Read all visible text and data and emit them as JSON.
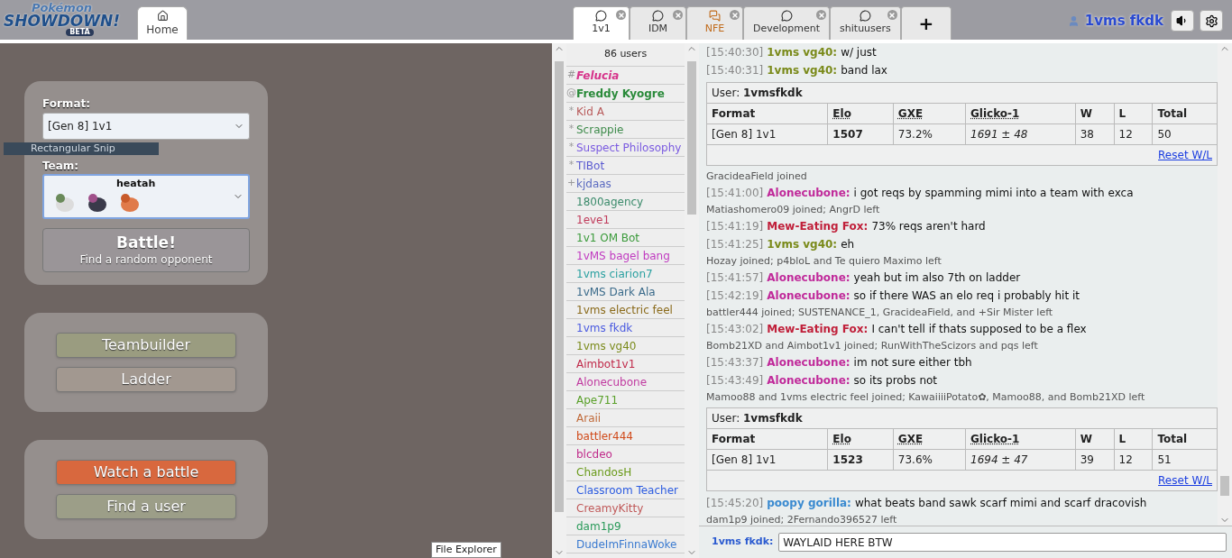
{
  "logo": {
    "line_1": "Pokémon",
    "line_2": "SHOWDOWN!",
    "badge": "BETA"
  },
  "home_tab": {
    "label": "Home",
    "selected": true
  },
  "room_tabs": [
    {
      "label": "1v1",
      "selected": true,
      "notify": false
    },
    {
      "label": "IDM",
      "selected": false,
      "notify": false
    },
    {
      "label": "NFE",
      "selected": false,
      "notify": true
    },
    {
      "label": "Development",
      "selected": false,
      "notify": false
    },
    {
      "label": "shituusers",
      "selected": false,
      "notify": false
    }
  ],
  "new_tab": "+",
  "account": {
    "username": "1vms fkdk"
  },
  "main_menu": {
    "format_label": "Format:",
    "format_value": "[Gen 8] 1v1",
    "team_label": "Team:",
    "team_name": "heatah",
    "battle_button": {
      "title": "Battle!",
      "subtitle": "Find a random opponent"
    },
    "menu_groups": [
      [
        {
          "label": "Teambuilder",
          "color": "#9a9c80"
        },
        {
          "label": "Ladder",
          "color": "#a29890"
        }
      ],
      [
        {
          "label": "Watch a battle",
          "color": "#d8683e"
        },
        {
          "label": "Find a user",
          "color": "#9c9e88"
        }
      ]
    ]
  },
  "overlays": {
    "snip_label": "Rectangular Snip",
    "tooltip": "File Explorer"
  },
  "userlist": {
    "count": "86 users",
    "users": [
      {
        "rank": "#",
        "name": "Felucia",
        "color": "#d6338a",
        "kind": "bold-italic"
      },
      {
        "rank": "@",
        "name": "Freddy Kyogre",
        "color": "#2a8a3a",
        "kind": "bold"
      },
      {
        "rank": "*",
        "name": "Kid A",
        "color": "#b85a5a",
        "kind": "normal"
      },
      {
        "rank": "*",
        "name": "Scrappie",
        "color": "#3d8a4a",
        "kind": "normal"
      },
      {
        "rank": "*",
        "name": "Suspect Philosophy",
        "color": "#7a5ae0",
        "kind": "normal"
      },
      {
        "rank": "*",
        "name": "TIBot",
        "color": "#5a5ad0",
        "kind": "normal"
      },
      {
        "rank": "+",
        "name": "kjdaas",
        "color": "#5a6ac0",
        "kind": "normal"
      },
      {
        "name": "1800agency",
        "color": "#3a8a6a",
        "kind": "normal"
      },
      {
        "name": "1eve1",
        "color": "#c03a5a",
        "kind": "normal"
      },
      {
        "name": "1v1 OM Bot",
        "color": "#3a9a3a",
        "kind": "normal"
      },
      {
        "name": "1vMS bagel bang",
        "color": "#c03ac0",
        "kind": "normal"
      },
      {
        "name": "1vms ciarion7",
        "color": "#2aa0a0",
        "kind": "normal"
      },
      {
        "name": "1vMS Dark Ala",
        "color": "#3a6a8a",
        "kind": "normal"
      },
      {
        "name": "1vms electric feel",
        "color": "#8a6a1a",
        "kind": "normal"
      },
      {
        "name": "1vms fkdk",
        "color": "#4a5ae0",
        "kind": "normal"
      },
      {
        "name": "1vms vg40",
        "color": "#7a8a1a",
        "kind": "normal"
      },
      {
        "name": "Aimbot1v1",
        "color": "#c02a4a",
        "kind": "normal"
      },
      {
        "name": "Alonecubone",
        "color": "#c03aa0",
        "kind": "normal"
      },
      {
        "name": "Ape711",
        "color": "#5aa02a",
        "kind": "normal"
      },
      {
        "name": "Araii",
        "color": "#c06a3a",
        "kind": "normal"
      },
      {
        "name": "battler444",
        "color": "#d04a1a",
        "kind": "normal"
      },
      {
        "name": "blcdeo",
        "color": "#c02a8a",
        "kind": "normal"
      },
      {
        "name": "ChandosH",
        "color": "#6a9a1a",
        "kind": "normal"
      },
      {
        "name": "Classroom Teacher",
        "color": "#2a5ae0",
        "kind": "normal"
      },
      {
        "name": "CreamyKitty",
        "color": "#c05a5a",
        "kind": "normal"
      },
      {
        "name": "dam1p9",
        "color": "#2a9a5a",
        "kind": "normal"
      },
      {
        "name": "DudeImFinnaWoke",
        "color": "#3a7ad0",
        "kind": "normal"
      }
    ]
  },
  "chat": {
    "lines": [
      {
        "kind": "message",
        "time": "[15:40:30]",
        "user": "1vms vg40:",
        "color": "#7a8a1a",
        "text": "w/ just"
      },
      {
        "kind": "message",
        "time": "[15:40:31]",
        "user": "1vms vg40:",
        "color": "#7a8a1a",
        "text": "band lax"
      },
      {
        "kind": "ladder",
        "user_label": "User:",
        "user": "1vmsfkdk",
        "columns": [
          {
            "label": "Format",
            "abbr": false
          },
          {
            "label": "Elo",
            "abbr": true
          },
          {
            "label": "GXE",
            "abbr": true
          },
          {
            "label": "Glicko-1",
            "abbr": true
          },
          {
            "label": "W",
            "abbr": false
          },
          {
            "label": "L",
            "abbr": false
          },
          {
            "label": "Total",
            "abbr": false
          }
        ],
        "row": [
          "[Gen 8] 1v1",
          "1507",
          "73.2%",
          "1691 ± 48",
          "38",
          "12",
          "50"
        ],
        "link": "Reset W/L"
      },
      {
        "kind": "notice",
        "text": "GracideaField joined"
      },
      {
        "kind": "message",
        "time": "[15:41:00]",
        "user": "Alonecubone:",
        "color": "#c02a9a",
        "text": "i got reqs by spamming mimi into a team with exca"
      },
      {
        "kind": "notice",
        "text": "Matiashomero09 joined; AngrD left"
      },
      {
        "kind": "message",
        "time": "[15:41:19]",
        "user": "Mew-Eating Fox:",
        "color": "#c0203a",
        "text": "73% reqs aren't hard"
      },
      {
        "kind": "message",
        "time": "[15:41:25]",
        "user": "1vms vg40:",
        "color": "#7a8a1a",
        "text": "eh"
      },
      {
        "kind": "notice",
        "text": "Hozay joined; p4bloL and Te quiero Maximo left"
      },
      {
        "kind": "message",
        "time": "[15:41:57]",
        "user": "Alonecubone:",
        "color": "#c02a9a",
        "text": "yeah but im also 7th on ladder"
      },
      {
        "kind": "message",
        "time": "[15:42:19]",
        "user": "Alonecubone:",
        "color": "#c02a9a",
        "text": "so if there WAS an elo req i probably hit it"
      },
      {
        "kind": "notice",
        "text": "battler444 joined; SUSTENANCE_1, GracideaField, and +Sir Mister left"
      },
      {
        "kind": "message",
        "time": "[15:43:02]",
        "user": "Mew-Eating Fox:",
        "color": "#c0203a",
        "text": "I can't tell if thats supposed to be a flex"
      },
      {
        "kind": "notice",
        "text": "Bomb21XD and Aimbot1v1 joined; RunWithTheScizors and pqs left"
      },
      {
        "kind": "message",
        "time": "[15:43:37]",
        "user": "Alonecubone:",
        "color": "#c02a9a",
        "text": "im not sure either tbh"
      },
      {
        "kind": "message",
        "time": "[15:43:49]",
        "user": "Alonecubone:",
        "color": "#c02a9a",
        "text": "so its probs not"
      },
      {
        "kind": "notice",
        "text": "Mamoo88 and 1vms electric feel joined; KawaiiiiPotato✿, Mamoo88, and Bomb21XD left"
      },
      {
        "kind": "ladder",
        "user_label": "User:",
        "user": "1vmsfkdk",
        "columns": [
          {
            "label": "Format",
            "abbr": false
          },
          {
            "label": "Elo",
            "abbr": true
          },
          {
            "label": "GXE",
            "abbr": true
          },
          {
            "label": "Glicko-1",
            "abbr": true
          },
          {
            "label": "W",
            "abbr": false
          },
          {
            "label": "L",
            "abbr": false
          },
          {
            "label": "Total",
            "abbr": false
          }
        ],
        "row": [
          "[Gen 8] 1v1",
          "1523",
          "73.6%",
          "1694 ± 47",
          "39",
          "12",
          "51"
        ],
        "link": "Reset W/L"
      },
      {
        "kind": "message",
        "time": "[15:45:20]",
        "user": "poopy gorilla:",
        "color": "#3a8ad0",
        "text": "what beats band sawk scarf mimi and scarf dracovish"
      },
      {
        "kind": "notice",
        "text": "dam1p9 joined; 2Fernando396527 left"
      }
    ],
    "input_label": "1vms fkdk:",
    "input_value": "WAYLAID HERE BTW"
  }
}
